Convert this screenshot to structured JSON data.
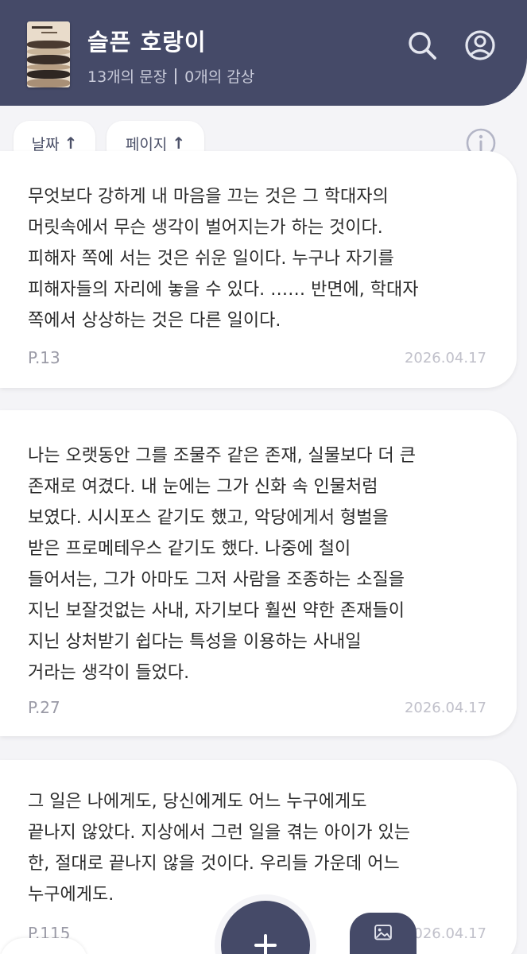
{
  "header": {
    "title": "슬픈 호랑이",
    "sentences": "13개의 문장",
    "reviews": "0개의 감상"
  },
  "sort": {
    "date_label": "날짜",
    "page_label": "페이지",
    "arrow": "↑"
  },
  "icons": {
    "search": "search-icon",
    "profile": "profile-icon",
    "info": "info-icon",
    "add": "plus-icon",
    "image": "image-icon"
  },
  "colors": {
    "primary": "#454a68",
    "background": "#f4f4f7",
    "card": "#ffffff"
  },
  "quotes": [
    {
      "text": "무엇보다 강하게 내 마음을 끄는 것은 그 학대자의\n머릿속에서 무슨 생각이 벌어지는가 하는 것이다.\n피해자 쪽에 서는 것은 쉬운 일이다. 누구나 자기를\n피해자들의 자리에 놓을 수 있다. …… 반면에, 학대자\n쪽에서 상상하는 것은 다른 일이다.",
      "page": "P.13",
      "date": "2026.04.17"
    },
    {
      "text": "나는 오랫동안 그를 조물주 같은 존재, 실물보다 더 큰\n존재로 여겼다. 내 눈에는 그가 신화 속 인물처럼\n보였다. 시시포스 같기도 했고, 악당에게서 형벌을\n받은 프로메테우스 같기도 했다. 나중에 철이\n들어서는, 그가 아마도 그저 사람을 조종하는 소질을\n지닌 보잘것없는 사내, 자기보다 훨씬 약한 존재들이\n지닌 상처받기 쉽다는 특성을 이용하는 사내일\n거라는 생각이 들었다.",
      "page": "P.27",
      "date": "2026.04.17"
    },
    {
      "text": "그 일은 나에게도, 당신에게도 어느 누구에게도\n끝나지 않았다. 지상에서 그런 일을 겪는 아이가 있는\n한, 절대로 끝나지 않을 것이다. 우리들 가운데 어느\n누구에게도.",
      "page": "P.115",
      "date": "2026.04.17"
    }
  ]
}
